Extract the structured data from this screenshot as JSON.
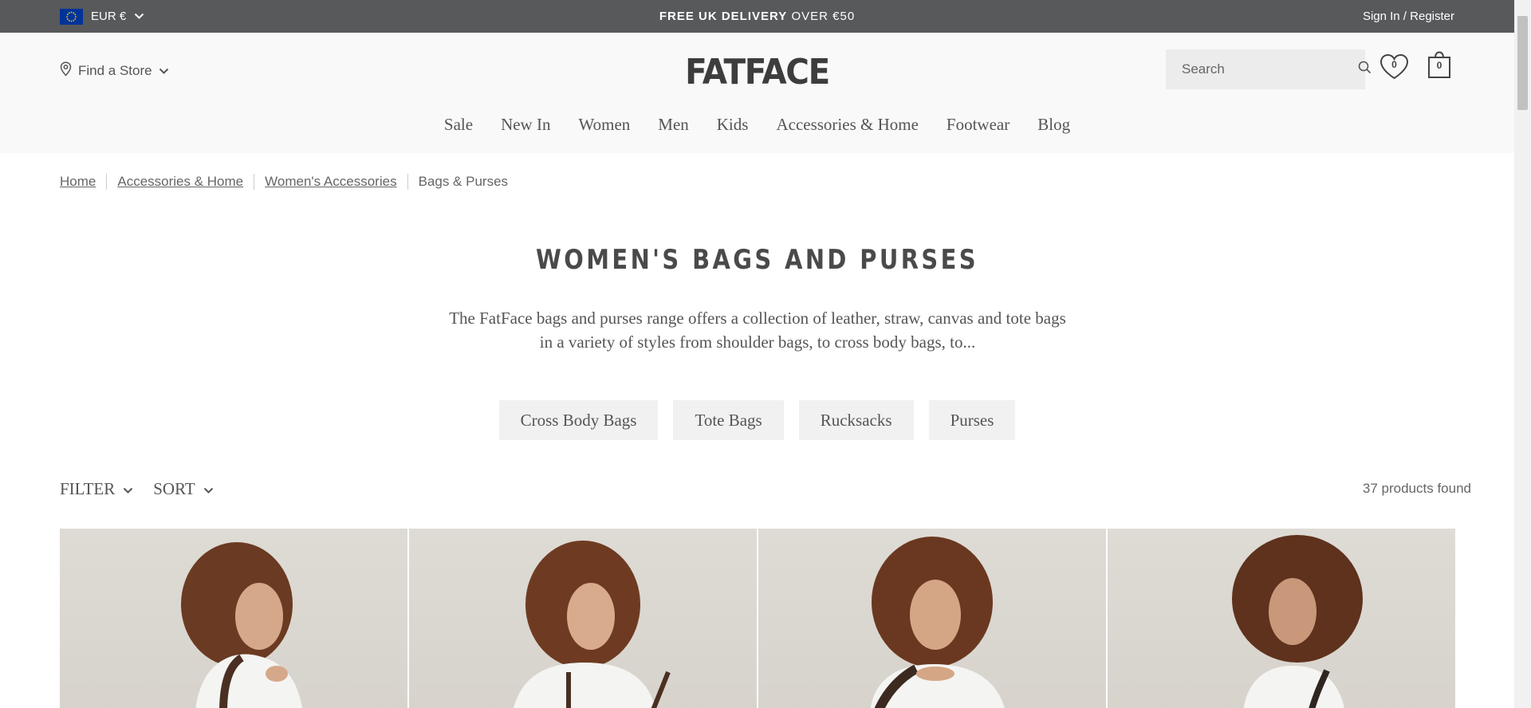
{
  "topbar": {
    "currency_label": "EUR €",
    "promo_bold": "FREE UK DELIVERY",
    "promo_rest": " OVER €50",
    "signin_label": "Sign In / Register"
  },
  "header": {
    "find_store_label": "Find a Store",
    "logo_text": "FATFACE",
    "search_placeholder": "Search",
    "wishlist_count": "0",
    "bag_count": "0"
  },
  "nav": {
    "items": [
      {
        "label": "Sale"
      },
      {
        "label": "New In"
      },
      {
        "label": "Women"
      },
      {
        "label": "Men"
      },
      {
        "label": "Kids"
      },
      {
        "label": "Accessories & Home"
      },
      {
        "label": "Footwear"
      },
      {
        "label": "Blog"
      }
    ]
  },
  "breadcrumb": {
    "items": [
      {
        "label": "Home"
      },
      {
        "label": "Accessories & Home"
      },
      {
        "label": "Women's Accessories"
      },
      {
        "label": "Bags & Purses"
      }
    ]
  },
  "page": {
    "title": "WOMEN'S BAGS AND PURSES",
    "description": "The FatFace bags and purses range offers a collection of leather, straw, canvas and tote bags in a variety of styles from shoulder bags, to cross body bags, to..."
  },
  "categories": [
    {
      "label": "Cross Body Bags"
    },
    {
      "label": "Tote Bags"
    },
    {
      "label": "Rucksacks"
    },
    {
      "label": "Purses"
    }
  ],
  "filterbar": {
    "filter_label": "FILTER",
    "sort_label": "SORT",
    "products_found": "37 products found"
  },
  "colors": {
    "topbar_bg": "#58595b",
    "header_bg": "#f9f9f9",
    "chip_bg": "#f1f1f1",
    "text": "#555555",
    "eu_flag_blue": "#003399",
    "eu_flag_stars": "#ffcc00"
  },
  "icons": {
    "flag": "eu-flag-icon",
    "chevron": "chevron-down-icon",
    "location": "location-pin-icon",
    "search": "search-icon",
    "wishlist": "heart-icon",
    "bag": "shopping-bag-icon"
  }
}
